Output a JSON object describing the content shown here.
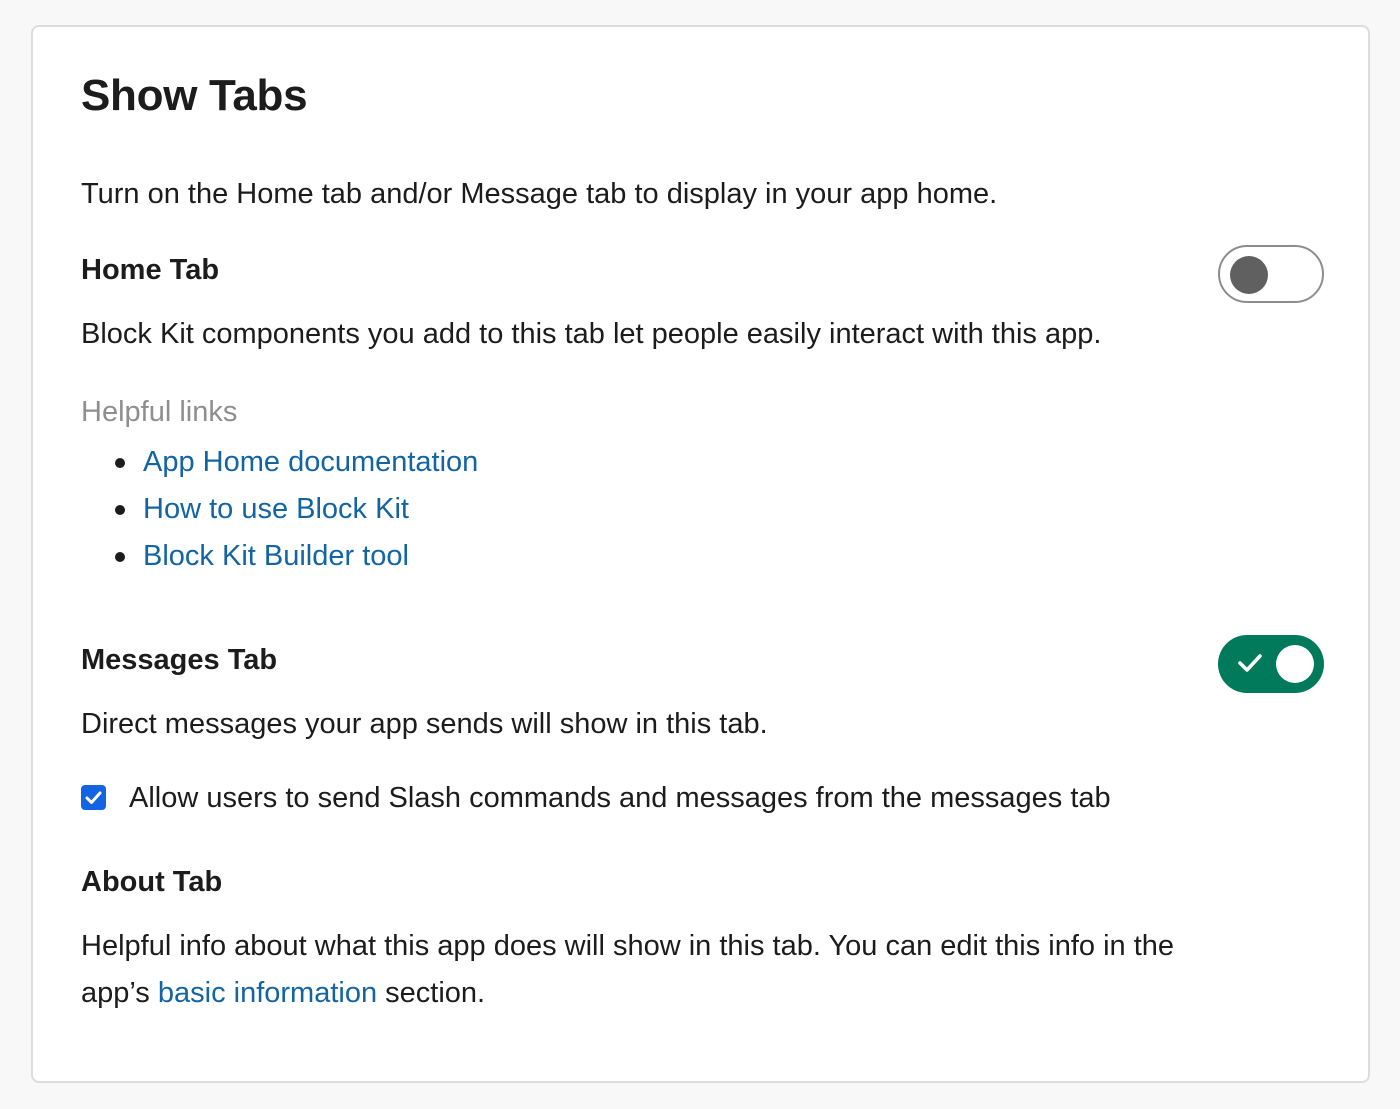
{
  "page": {
    "title": "Show Tabs",
    "intro": "Turn on the Home tab and/or Message tab to display in your app home."
  },
  "home_tab": {
    "title": "Home Tab",
    "toggle_state": "off",
    "description": "Block Kit components you add to this tab let people easily interact with this app.",
    "helpful_links_label": "Helpful links",
    "links": [
      {
        "label": "App Home documentation"
      },
      {
        "label": "How to use Block Kit"
      },
      {
        "label": "Block Kit Builder tool"
      }
    ]
  },
  "messages_tab": {
    "title": "Messages Tab",
    "toggle_state": "on",
    "description": "Direct messages your app sends will show in this tab.",
    "checkbox_checked": true,
    "checkbox_label": "Allow users to send Slash commands and messages from the messages tab"
  },
  "about_tab": {
    "title": "About Tab",
    "description_line1": "Helpful info about what this app does will show in this tab. You can edit this info in the",
    "description_prefix": "app’s ",
    "link_label": "basic information",
    "description_suffix": " section."
  },
  "colors": {
    "toggle_on": "#007a5a",
    "link": "#1264a3",
    "checkbox": "#1264e3",
    "muted_text": "#8e8e8e"
  },
  "icons": {
    "toggle_on_indicator": "check-icon",
    "checkbox_indicator": "checkmark-icon"
  }
}
